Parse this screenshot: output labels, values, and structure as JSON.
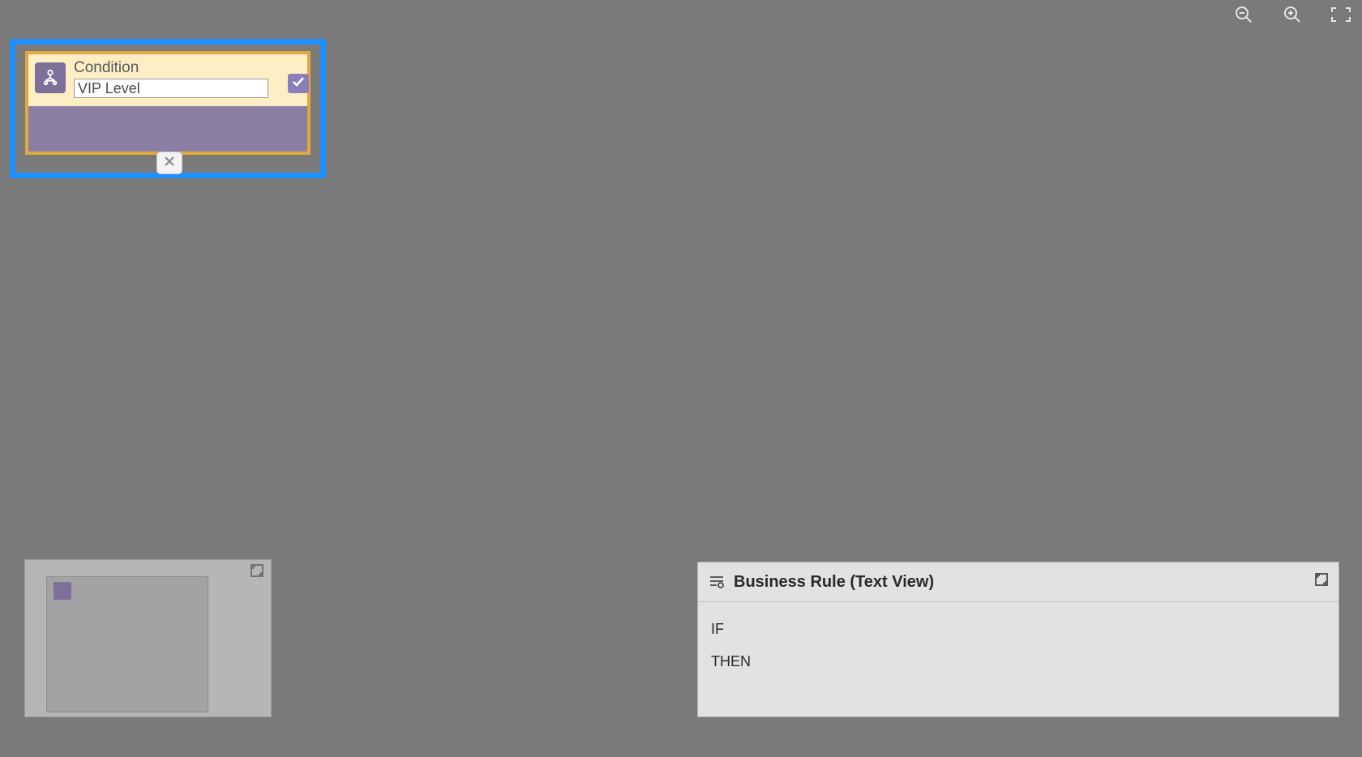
{
  "toolbar": {
    "zoom_out": "zoom-out",
    "zoom_in": "zoom-in",
    "fit": "fit-to-screen"
  },
  "condition": {
    "label": "Condition",
    "value": "VIP Level",
    "close": "×"
  },
  "minimap": {
    "expand": "expand"
  },
  "textview": {
    "title": "Business Rule (Text View)",
    "lines": {
      "if": "IF",
      "then": "THEN"
    }
  }
}
